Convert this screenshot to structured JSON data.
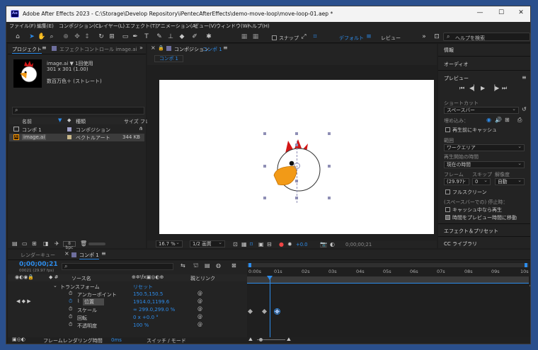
{
  "window": {
    "title": "Adobe After Effects 2023 - C:\\Storage\\Develop Repository\\iPentecAfterEffects\\demo-move-loop\\move-loop-01.aep *",
    "app_badge": "Ae"
  },
  "menu": [
    "ファイル(F)",
    "編集(E)",
    "コンポジション(C)",
    "レイヤー(L)",
    "エフェクト(T)",
    "アニメーション(A)",
    "ビュー(V)",
    "ウィンドウ(W)",
    "ヘルプ(H)"
  ],
  "toolbar": {
    "snap_label": "スナップ",
    "workspace": "デフォルト",
    "review": "レビュー",
    "search_placeholder": "ヘルプを検索"
  },
  "project": {
    "tab": "プロジェクト",
    "effect_tab": "エフェクトコントロール image.ai",
    "asset_name": "image.ai ▼ 1回使用",
    "asset_size": "301 x 301 (1.00)",
    "asset_color": "数百万色＋ (ストレート)",
    "columns": {
      "name": "名前",
      "type": "種類",
      "size": "サイズ",
      "fr": "フレ"
    },
    "items": [
      {
        "name": "コンポ 1",
        "type": "コンポジション",
        "size": ""
      },
      {
        "name": "image.ai",
        "type": "ベクトルアート",
        "size": "344 KB"
      }
    ],
    "bpc": "8 bpc"
  },
  "composition": {
    "tab": "コンポジション",
    "tab_name": "コンポ 1",
    "subtab": "コンポ 1",
    "zoom": "16.7 %",
    "quality": "1/2 画質",
    "exposure": "+0.0",
    "timecode": "0;00;00;21"
  },
  "right_panel": {
    "info": "情報",
    "audio": "オーディオ",
    "preview": "プレビュー",
    "shortcut_label": "ショートカット",
    "shortcut_value": "スペースバー",
    "include_label": "埋め込み：",
    "cache_before": "再生前にキャッシュ",
    "range_label": "範囲",
    "range_value": "ワークエリア",
    "start_label": "再生開始の時間",
    "start_value": "現在の時間",
    "frame_label": "フレーム",
    "skip_label": "スキップ",
    "res_label": "解像度",
    "frame_value": "(29.97)",
    "skip_value": "0",
    "res_value": "自動",
    "fullscreen": "フルスクリーン",
    "stop_label": "(スペースバーでの) 停止時：",
    "cache_play": "キャッシュ中なら再生",
    "move_time": "時間をプレビュー時間に移動",
    "effects": "エフェクト＆プリセット",
    "libraries": "CC ライブラリ"
  },
  "timeline": {
    "render_tab": "レンダーキュー",
    "comp_tab": "コンポ 1",
    "timecode": "0;00;00;21",
    "timecode_sub": "00021 (29.97 fps)",
    "columns": {
      "source": "ソース名",
      "parent": "親とリンク"
    },
    "ruler": [
      "0:00s",
      "01s",
      "02s",
      "03s",
      "04s",
      "05s",
      "06s",
      "07s",
      "08s",
      "09s",
      "10s"
    ],
    "rows": [
      {
        "label": "トランスフォーム",
        "value": "リセット"
      },
      {
        "label": "アンカーポイント",
        "value": "150.5,150.5"
      },
      {
        "label": "位置",
        "value": "1914.0,1199.6"
      },
      {
        "label": "スケール",
        "value": "∞ 299.0,299.0 %"
      },
      {
        "label": "回転",
        "value": "0 x +0.0 °"
      },
      {
        "label": "不透明度",
        "value": "100 %"
      }
    ],
    "footer_label": "フレームレンダリング時間",
    "footer_value": "0ms",
    "switch_mode": "スイッチ / モード"
  }
}
